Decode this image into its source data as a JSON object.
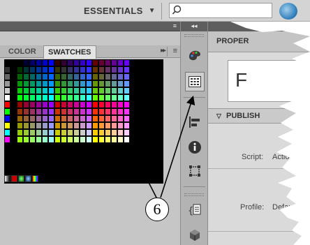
{
  "topbar": {
    "workspace_label": "ESSENTIALS",
    "workspace_caret": "▼",
    "search_placeholder": ""
  },
  "swatches_panel": {
    "tabs": [
      {
        "label": "COLOR",
        "active": false
      },
      {
        "label": "SWATCHES",
        "active": true
      }
    ],
    "panel_collapse_glyph": "▸▸",
    "panel_menu_glyph": "≡"
  },
  "toolstrip": {
    "collapse_glyph": "◂◂",
    "tools": [
      {
        "name": "color-palette-icon",
        "selected": false
      },
      {
        "name": "swatches-grid-icon",
        "selected": true
      },
      {
        "name": "align-icon",
        "selected": false
      },
      {
        "name": "info-icon",
        "selected": false
      },
      {
        "name": "transform-icon",
        "selected": false
      },
      {
        "name": "code-snippets-icon",
        "selected": false
      },
      {
        "name": "components-icon",
        "selected": false
      }
    ]
  },
  "properties_panel": {
    "tab_label": "PROPER",
    "name_glyph": "F",
    "publish_label": "PUBLISH",
    "publish_arrow": "▽",
    "script_label": "Script:",
    "script_value": "Actio",
    "profile_label": "Profile:",
    "profile_value": "Defau"
  },
  "annotation": {
    "callout_number": "6"
  },
  "colors": {
    "panel_bg": "#c6c6c6",
    "header_dark": "#5e5e5e",
    "accent_icon": "#2a78b5"
  }
}
